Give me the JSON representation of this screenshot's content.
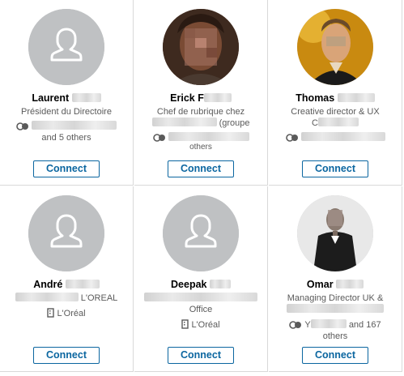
{
  "connect_label": "Connect",
  "cards": [
    {
      "first_name": "Laurent",
      "headline": "Président du Directoire",
      "shared": "and 5 others"
    },
    {
      "first_name": "Erick",
      "name_tail": "F",
      "headline": "Chef de rubrique chez",
      "headline2": "(groupe",
      "shared": "others"
    },
    {
      "first_name": "Thomas",
      "headline": "Creative director & UX",
      "headline2": "C",
      "shared": ""
    },
    {
      "first_name": "André",
      "headline": "L'OREAL",
      "company": "L'Oréal"
    },
    {
      "first_name": "Deepak",
      "headline": "Office",
      "company": "L'Oréal"
    },
    {
      "first_name": "Omar",
      "headline": "Managing Director UK &",
      "shared": "Y",
      "shared_suffix": "and 167",
      "shared2": "others"
    }
  ],
  "icons": {
    "placeholder": "person-silhouette-icon",
    "shared": "shared-connections-icon",
    "company": "building-icon"
  }
}
